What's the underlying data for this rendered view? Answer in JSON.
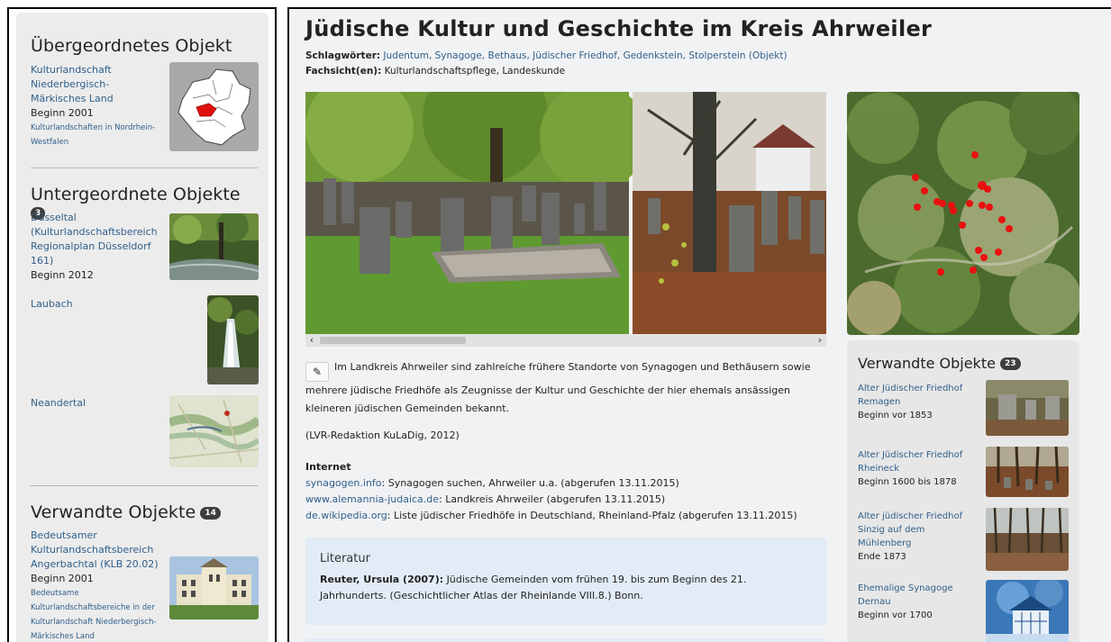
{
  "left": {
    "parent": {
      "heading": "Übergeordnetes Objekt",
      "title": "Kulturlandschaft Niederbergisch-Märkisches Land",
      "begin": "Beginn 2001",
      "sub": "Kulturlandschaften in Nordrhein-Westfalen"
    },
    "children": {
      "heading": "Untergeordnete Objekte",
      "count": "3",
      "items": [
        {
          "title": "Düsseltal (Kulturlandschaftsbereich Regionalplan Düsseldorf 161)",
          "begin": "Beginn 2012"
        },
        {
          "title": "Laubach",
          "begin": ""
        },
        {
          "title": "Neandertal",
          "begin": ""
        }
      ]
    },
    "related": {
      "heading": "Verwandte Objekte",
      "count": "14",
      "items": [
        {
          "title": "Bedeutsamer Kulturlandschaftsbereich Angerbachtal (KLB 20.02)",
          "begin": "Beginn 2001",
          "sub": "Bedeutsame Kulturlandschaftsbereiche in der Kulturlandschaft Niederbergisch-Märkisches Land"
        }
      ]
    }
  },
  "main": {
    "title": "Jüdische Kultur und Geschichte im Kreis Ahrweiler",
    "keywords_label": "Schlagwörter:",
    "keywords": "Judentum, Synagoge, Bethaus, Jüdischer Friedhof, Gedenkstein, Stolperstein (Objekt)",
    "views_label": "Fachsicht(en):",
    "views": "Kulturlandschaftspflege, Landeskunde",
    "edit_icon": "✎",
    "description": "Im Landkreis Ahrweiler sind zahlreiche frühere Standorte von Synagogen und Bethäusern sowie mehrere jüdische Friedhöfe als Zeugnisse der Kultur und Geschichte der hier ehemals ansässigen kleineren jüdischen Gemeinden bekannt.",
    "credit": "(LVR-Redaktion KuLaDig, 2012)",
    "internet_label": "Internet",
    "links": [
      {
        "link": "synagogen.info",
        "text": ": Synagogen suchen, Ahrweiler u.a. (abgerufen 13.11.2015)"
      },
      {
        "link": "www.alemannia-judaica.de",
        "text": ": Landkreis Ahrweiler (abgerufen 13.11.2015)"
      },
      {
        "link": "de.wikipedia.org",
        "text": ": Liste jüdischer Friedhöfe in Deutschland, Rheinland-Pfalz (abgerufen 13.11.2015)"
      }
    ],
    "literature": {
      "title": "Literatur",
      "author": "Reuter, Ursula (2007):",
      "text": " Jüdische Gemeinden vom frühen 19. bis zum Beginn des 21. Jahrhunderts. (Geschichtlicher Atlas der Rheinlande VIII.8.) Bonn."
    },
    "scroll_left": "‹",
    "scroll_right": "›"
  },
  "related_right": {
    "heading": "Verwandte Objekte",
    "count": "23",
    "items": [
      {
        "title": "Alter Jüdischer Friedhof Remagen",
        "begin": "Beginn vor 1853"
      },
      {
        "title": "Alter Jüdischer Friedhof Rheineck",
        "begin": "Beginn 1600 bis 1878"
      },
      {
        "title": "Alter jüdischer Friedhof Sinzig auf dem Mühlenberg",
        "begin": "Ende 1873"
      },
      {
        "title": "Ehemalige Synagoge Dernau",
        "begin": "Beginn vor 1700"
      }
    ]
  },
  "colors": {
    "link": "#2f5f8a",
    "panel": "#ececec",
    "literature_bg": "#e2ecf6",
    "map_dot": "#e81010"
  }
}
